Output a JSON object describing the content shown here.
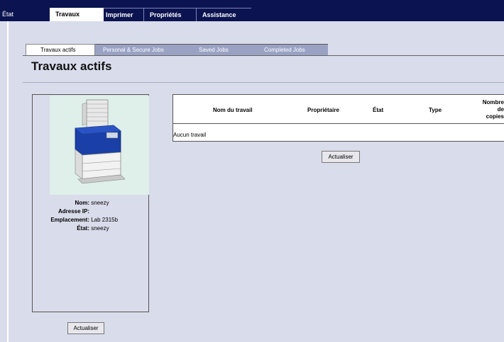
{
  "nav": {
    "tabs": [
      {
        "label": "État"
      },
      {
        "label": "Travaux"
      },
      {
        "label": "Imprimer"
      },
      {
        "label": "Propriétés"
      },
      {
        "label": "Assistance"
      }
    ],
    "active_tab": "Travaux"
  },
  "subnav": {
    "tabs": [
      {
        "label": "Travaux actifs"
      },
      {
        "label": "Personal & Secure Jobs"
      },
      {
        "label": "Saved Jobs"
      },
      {
        "label": "Completed Jobs"
      }
    ],
    "active_tab": "Travaux actifs"
  },
  "page": {
    "title": "Travaux actifs"
  },
  "printer": {
    "name_label": "Nom:",
    "name_value": "sneezy",
    "ip_label": "Adresse IP:",
    "ip_value": "",
    "location_label": "Emplacement:",
    "location_value": "Lab 2315b",
    "status_label": "État:",
    "status_value": "sneezy",
    "refresh_label": "Actualiser"
  },
  "jobs": {
    "columns": [
      "Nom du travail",
      "Propriétaire",
      "État",
      "Type",
      "Nombre de copies"
    ],
    "copies_line1": "Nombre de",
    "copies_line2": "copies",
    "empty_text": "Aucun travail",
    "refresh_label": "Actualiser"
  },
  "colors": {
    "nav_bg": "#0b1450",
    "page_bg": "#d9dcea",
    "subtab_inactive": "#9aa2c4"
  }
}
